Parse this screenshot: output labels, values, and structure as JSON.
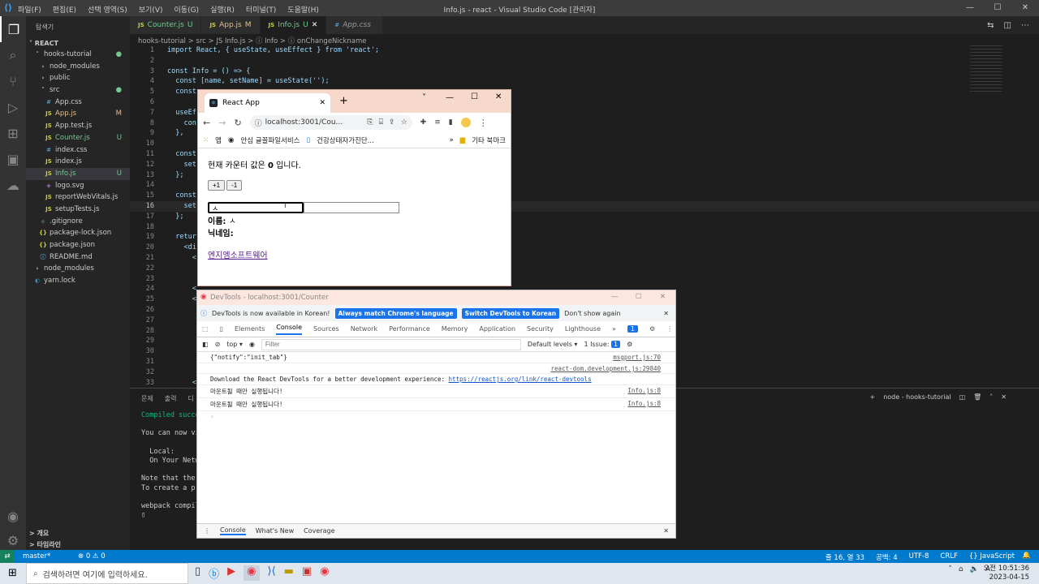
{
  "vscode": {
    "menu": [
      "파일(F)",
      "편집(E)",
      "선택 영역(S)",
      "보기(V)",
      "이동(G)",
      "실행(R)",
      "터미널(T)",
      "도움말(H)"
    ],
    "title": "Info.js - react - Visual Studio Code [관리자]",
    "explorer_label": "탐색기",
    "section_react": "REACT",
    "tree": [
      {
        "label": "hooks-tutorial",
        "indent": 1,
        "kind": "folder-open",
        "status": "●"
      },
      {
        "label": "node_modules",
        "indent": 2,
        "kind": "folder",
        "status": ""
      },
      {
        "label": "public",
        "indent": 2,
        "kind": "folder",
        "status": ""
      },
      {
        "label": "src",
        "indent": 2,
        "kind": "folder-open",
        "status": "●"
      },
      {
        "label": "App.css",
        "indent": 3,
        "kind": "css",
        "status": ""
      },
      {
        "label": "App.js",
        "indent": 3,
        "kind": "js",
        "status": "M"
      },
      {
        "label": "App.test.js",
        "indent": 3,
        "kind": "js",
        "status": ""
      },
      {
        "label": "Counter.js",
        "indent": 3,
        "kind": "js",
        "status": "U"
      },
      {
        "label": "index.css",
        "indent": 3,
        "kind": "css",
        "status": ""
      },
      {
        "label": "index.js",
        "indent": 3,
        "kind": "js",
        "status": ""
      },
      {
        "label": "Info.js",
        "indent": 3,
        "kind": "js",
        "status": "U"
      },
      {
        "label": "logo.svg",
        "indent": 3,
        "kind": "svg",
        "status": ""
      },
      {
        "label": "reportWebVitals.js",
        "indent": 3,
        "kind": "js",
        "status": ""
      },
      {
        "label": "setupTests.js",
        "indent": 3,
        "kind": "js",
        "status": ""
      },
      {
        "label": ".gitignore",
        "indent": 2,
        "kind": "git",
        "status": ""
      },
      {
        "label": "package-lock.json",
        "indent": 2,
        "kind": "json",
        "status": ""
      },
      {
        "label": "package.json",
        "indent": 2,
        "kind": "json",
        "status": ""
      },
      {
        "label": "README.md",
        "indent": 2,
        "kind": "md",
        "status": ""
      },
      {
        "label": "node_modules",
        "indent": 1,
        "kind": "folder",
        "status": ""
      },
      {
        "label": "yarn.lock",
        "indent": 1,
        "kind": "yarn",
        "status": ""
      }
    ],
    "outline_label": "개요",
    "timeline_label": "타임라인",
    "tabs": [
      {
        "label": "Counter.js",
        "status": "U",
        "active": false
      },
      {
        "label": "App.js",
        "status": "M",
        "active": false
      },
      {
        "label": "Info.js",
        "status": "U",
        "active": true
      },
      {
        "label": "App.css",
        "status": "",
        "active": false
      }
    ],
    "breadcrumb": "hooks-tutorial > src > JS Info.js > ⓘ Info > ⓘ onChangeNickname",
    "code": [
      {
        "n": "1",
        "t": "import React, { useState, useEffect } from 'react';"
      },
      {
        "n": "2",
        "t": ""
      },
      {
        "n": "3",
        "t": "const Info = () => {"
      },
      {
        "n": "4",
        "t": "  const [name, setName] = useState('');"
      },
      {
        "n": "5",
        "t": "  const"
      },
      {
        "n": "6",
        "t": ""
      },
      {
        "n": "7",
        "t": "  useEf"
      },
      {
        "n": "8",
        "t": "    con"
      },
      {
        "n": "9",
        "t": "  },"
      },
      {
        "n": "10",
        "t": ""
      },
      {
        "n": "11",
        "t": "  const"
      },
      {
        "n": "12",
        "t": "    set"
      },
      {
        "n": "13",
        "t": "  };"
      },
      {
        "n": "14",
        "t": ""
      },
      {
        "n": "15",
        "t": "  const"
      },
      {
        "n": "16",
        "t": "    set"
      },
      {
        "n": "17",
        "t": "  };"
      },
      {
        "n": "18",
        "t": ""
      },
      {
        "n": "19",
        "t": "  retur"
      },
      {
        "n": "20",
        "t": "    <di"
      },
      {
        "n": "21",
        "t": "      <"
      },
      {
        "n": "22",
        "t": ""
      },
      {
        "n": "23",
        "t": ""
      },
      {
        "n": "24",
        "t": "      <"
      },
      {
        "n": "25",
        "t": "      <"
      },
      {
        "n": "26",
        "t": ""
      },
      {
        "n": "27",
        "t": ""
      },
      {
        "n": "28",
        "t": ""
      },
      {
        "n": "29",
        "t": ""
      },
      {
        "n": "30",
        "t": ""
      },
      {
        "n": "31",
        "t": ""
      },
      {
        "n": "32",
        "t": ""
      },
      {
        "n": "33",
        "t": "      <"
      }
    ],
    "panel_tabs": [
      "문제",
      "출력",
      "디"
    ],
    "terminal_lines": [
      "Compiled succe",
      "",
      "You can now vi",
      "",
      "  Local:",
      "  On Your Netw",
      "",
      "Note that the d",
      "To create a pro",
      "",
      "webpack compile",
      "▯"
    ],
    "terminal_name": "node - hooks-tutorial",
    "status_left": [
      "master*",
      "⊗ 0 ⚠ 0"
    ],
    "status_right": [
      "줄 16, 열 33",
      "공백: 4",
      "UTF-8",
      "CRLF",
      "{} JavaScript"
    ]
  },
  "taskbar": {
    "search_placeholder": "검색하려면 여기에 입력하세요.",
    "time": "오전 10:51:36",
    "date": "2023-04-15"
  },
  "chrome": {
    "tab_title": "React App",
    "url": "localhost:3001/Cou...",
    "bookmarks": [
      "앱",
      "안심 글꼴파일서비스",
      "건강상태자가진단...",
      "기타 북마크"
    ],
    "counter_text_before": "현재 카운터 값은 ",
    "counter_value": "0",
    "counter_text_after": " 입니다.",
    "plus_label": "+1",
    "minus_label": "-1",
    "name_input_value": "ㅅ",
    "name_label": "이름:",
    "name_value": "ㅅ",
    "nickname_label": "닉네임:",
    "nickname_value": "",
    "link_text": "엔지엠소프트웨어"
  },
  "devtools": {
    "title": "DevTools - localhost:3001/Counter",
    "info_text": "DevTools is now available in Korean!",
    "btn_match": "Always match Chrome's language",
    "btn_switch": "Switch DevTools to Korean",
    "dont_show": "Don't show again",
    "tabs": [
      "Elements",
      "Console",
      "Sources",
      "Network",
      "Performance",
      "Memory",
      "Application",
      "Security",
      "Lighthouse"
    ],
    "active_tab": "Console",
    "issues_badge": "1",
    "context": "top",
    "filter_placeholder": "Filter",
    "levels": "Default levels",
    "issue_count": "1 Issue:",
    "issue_badge2": "1",
    "console_lines": [
      {
        "text": "{\"notify\":\"init_tab\"}",
        "src": "msgport.js:70"
      },
      {
        "text": "",
        "src": "react-dom.development.js:29840"
      },
      {
        "text": "Download the React DevTools for a better development experience: ",
        "link": "https://reactjs.org/link/react-devtools",
        "src": ""
      },
      {
        "text": "마운트될 때만 실행됩니다!",
        "src": "Info.js:8"
      },
      {
        "text": "마운트될 때만 실행됩니다!",
        "src": "Info.js:8"
      }
    ],
    "prompt": "›",
    "drawer_tabs": [
      "Console",
      "What's New",
      "Coverage"
    ]
  }
}
